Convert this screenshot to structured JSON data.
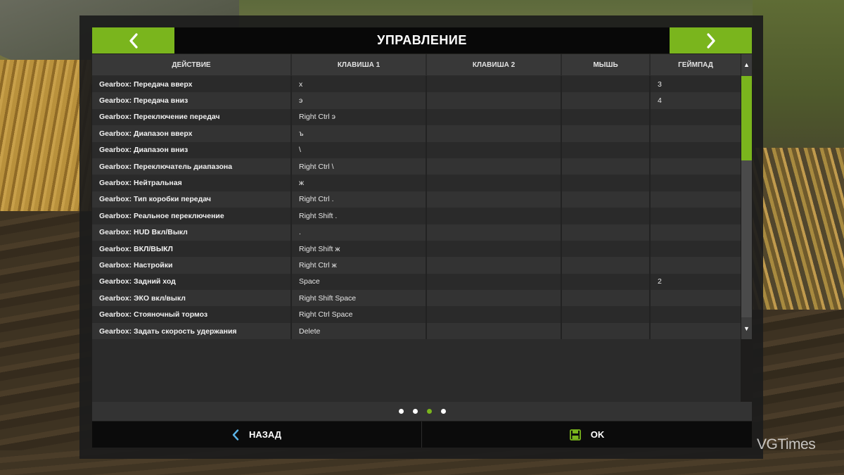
{
  "header": {
    "title": "УПРАВЛЕНИЕ"
  },
  "table": {
    "columns": [
      "ДЕЙСТВИЕ",
      "КЛАВИША 1",
      "КЛАВИША 2",
      "МЫШЬ",
      "ГЕЙМПАД"
    ],
    "rows": [
      {
        "action": "Gearbox: Передача вверх",
        "key1": "x",
        "key2": "",
        "mouse": "",
        "gamepad": "3"
      },
      {
        "action": "Gearbox: Передача вниз",
        "key1": "э",
        "key2": "",
        "mouse": "",
        "gamepad": "4"
      },
      {
        "action": "Gearbox: Переключение передач",
        "key1": "Right Ctrl э",
        "key2": "",
        "mouse": "",
        "gamepad": ""
      },
      {
        "action": "Gearbox: Диапазон вверх",
        "key1": "ъ",
        "key2": "",
        "mouse": "",
        "gamepad": ""
      },
      {
        "action": "Gearbox: Диапазон вниз",
        "key1": "\\",
        "key2": "",
        "mouse": "",
        "gamepad": ""
      },
      {
        "action": "Gearbox: Переключатель диапазона",
        "key1": "Right Ctrl \\",
        "key2": "",
        "mouse": "",
        "gamepad": ""
      },
      {
        "action": "Gearbox: Нейтральная",
        "key1": "ж",
        "key2": "",
        "mouse": "",
        "gamepad": ""
      },
      {
        "action": "Gearbox: Тип коробки передач",
        "key1": "Right Ctrl .",
        "key2": "",
        "mouse": "",
        "gamepad": ""
      },
      {
        "action": "Gearbox: Реальное переключение",
        "key1": "Right Shift .",
        "key2": "",
        "mouse": "",
        "gamepad": ""
      },
      {
        "action": "Gearbox: HUD Вкл/Выкл",
        "key1": ".",
        "key2": "",
        "mouse": "",
        "gamepad": ""
      },
      {
        "action": "Gearbox: ВКЛ/ВЫКЛ",
        "key1": "Right Shift ж",
        "key2": "",
        "mouse": "",
        "gamepad": ""
      },
      {
        "action": "Gearbox: Настройки",
        "key1": "Right Ctrl ж",
        "key2": "",
        "mouse": "",
        "gamepad": ""
      },
      {
        "action": "Gearbox: Задний ход",
        "key1": "Space",
        "key2": "",
        "mouse": "",
        "gamepad": "2"
      },
      {
        "action": "Gearbox: ЭКО вкл/выкл",
        "key1": "Right Shift Space",
        "key2": "",
        "mouse": "",
        "gamepad": ""
      },
      {
        "action": "Gearbox: Стояночный тормоз",
        "key1": "Right Ctrl Space",
        "key2": "",
        "mouse": "",
        "gamepad": ""
      },
      {
        "action": "Gearbox: Задать скорость удержания",
        "key1": "Delete",
        "key2": "",
        "mouse": "",
        "gamepad": ""
      }
    ]
  },
  "scrollbar": {
    "up_icon": "triangle-up-icon",
    "down_icon": "triangle-down-icon",
    "position": 0.0,
    "visible_fraction": 0.35
  },
  "pager": {
    "pages": 4,
    "current": 3
  },
  "footer": {
    "back_label": "НАЗАД",
    "back_icon": "chevron-left-icon",
    "ok_label": "OK",
    "ok_icon": "save-disk-icon"
  },
  "watermark": {
    "text": "VGTimes"
  },
  "colors": {
    "accent": "#7ab51d",
    "panel": "#1c1c1c",
    "header_bar": "#080808",
    "back_icon": "#5bb4e8"
  }
}
